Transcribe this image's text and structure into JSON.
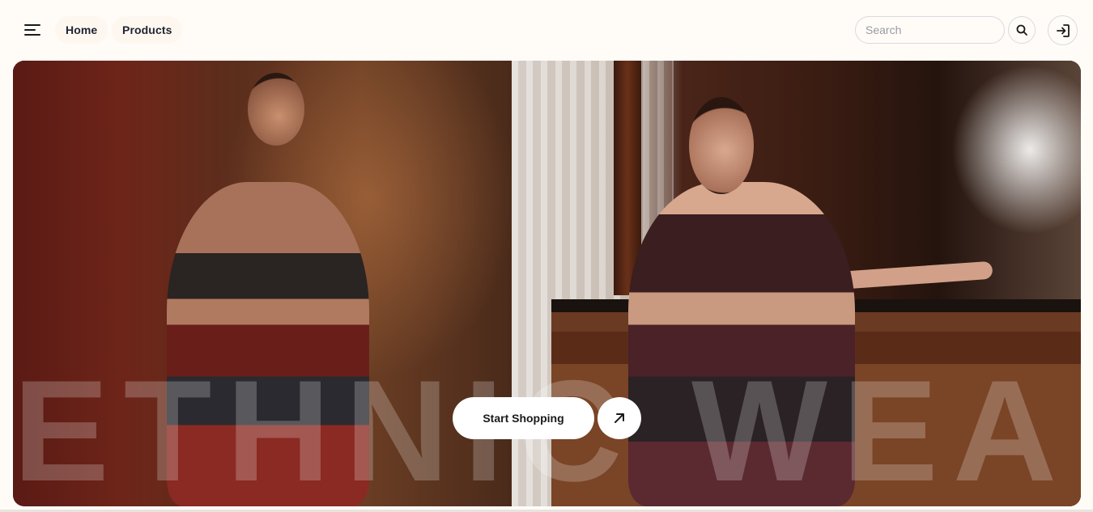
{
  "nav": {
    "menu_icon": "hamburger-menu-icon",
    "links": [
      {
        "label": "Home"
      },
      {
        "label": "Products"
      }
    ]
  },
  "search": {
    "placeholder": "Search",
    "value": "",
    "button_icon": "search-icon"
  },
  "login": {
    "icon": "login-arrow-icon"
  },
  "hero": {
    "watermark_text": "ETHNIC WEAR",
    "cta_label": "Start Shopping",
    "cta_icon": "arrow-up-right-icon"
  },
  "colors": {
    "page_background": "#fffcf8",
    "nav_text": "#1f2433",
    "cta_background": "#ffffff"
  }
}
